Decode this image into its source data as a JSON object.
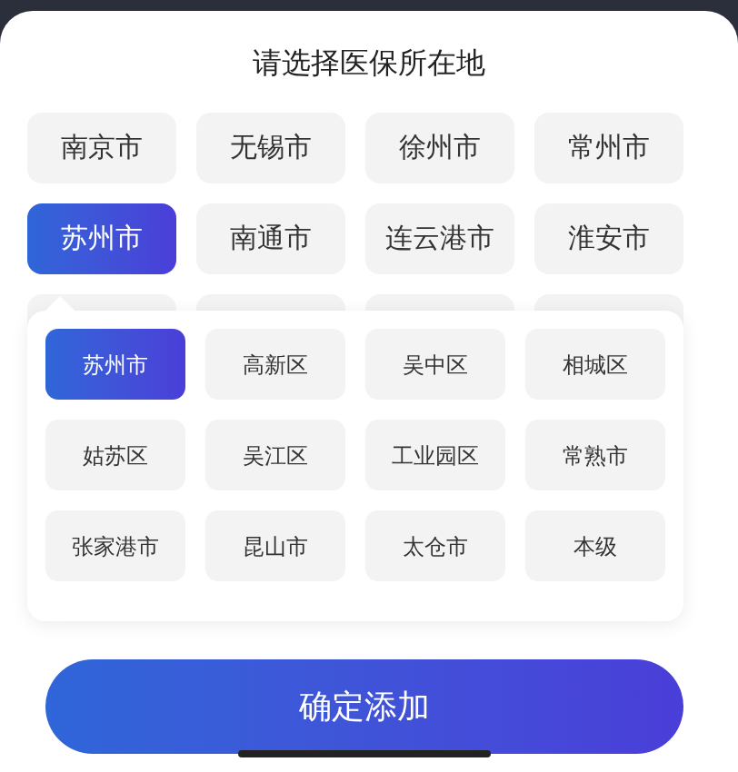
{
  "title": "请选择医保所在地",
  "cities": [
    {
      "label": "南京市",
      "selected": false
    },
    {
      "label": "无锡市",
      "selected": false
    },
    {
      "label": "徐州市",
      "selected": false
    },
    {
      "label": "常州市",
      "selected": false
    },
    {
      "label": "苏州市",
      "selected": true
    },
    {
      "label": "南通市",
      "selected": false
    },
    {
      "label": "连云港市",
      "selected": false
    },
    {
      "label": "淮安市",
      "selected": false
    }
  ],
  "districts": [
    {
      "label": "苏州市",
      "selected": true
    },
    {
      "label": "高新区",
      "selected": false
    },
    {
      "label": "吴中区",
      "selected": false
    },
    {
      "label": "相城区",
      "selected": false
    },
    {
      "label": "姑苏区",
      "selected": false
    },
    {
      "label": "吴江区",
      "selected": false
    },
    {
      "label": "工业园区",
      "selected": false
    },
    {
      "label": "常熟市",
      "selected": false
    },
    {
      "label": "张家港市",
      "selected": false
    },
    {
      "label": "昆山市",
      "selected": false
    },
    {
      "label": "太仓市",
      "selected": false
    },
    {
      "label": "本级",
      "selected": false
    }
  ],
  "confirm_button": "确定添加"
}
